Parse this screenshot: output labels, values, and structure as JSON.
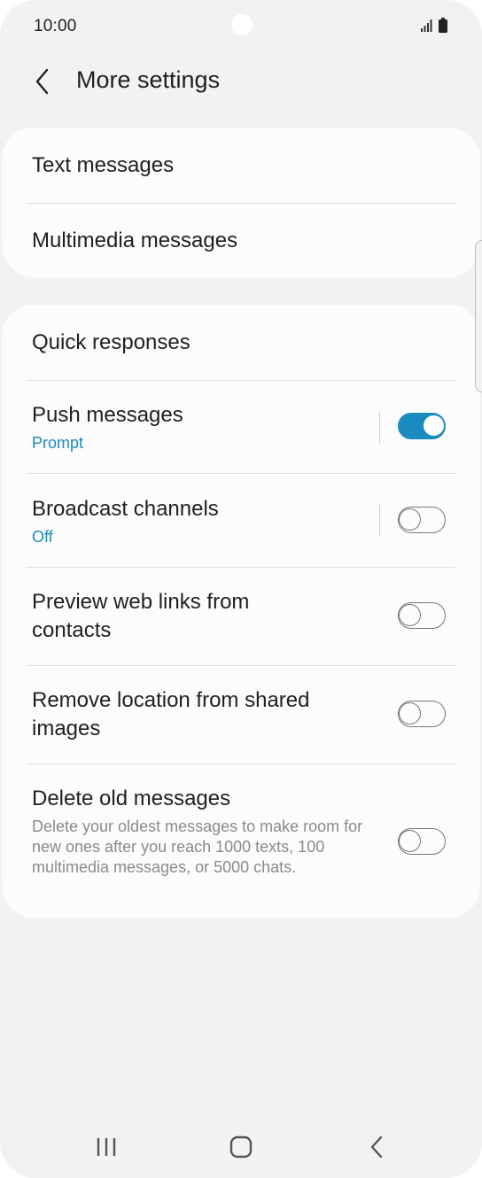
{
  "status_bar": {
    "time": "10:00",
    "icons": [
      "signal-icon",
      "battery-icon"
    ]
  },
  "app_bar": {
    "back_icon": "chevron-left-icon",
    "title": "More settings"
  },
  "group1": {
    "items": [
      {
        "label": "Text messages"
      },
      {
        "label": "Multimedia messages"
      }
    ]
  },
  "group2": {
    "quick_responses": {
      "label": "Quick responses"
    },
    "push_messages": {
      "label": "Push messages",
      "sub": "Prompt",
      "toggle_on": true
    },
    "broadcast_channels": {
      "label": "Broadcast channels",
      "sub": "Off",
      "toggle_on": false
    },
    "preview_links": {
      "line1": "Preview web links from",
      "line2": "contacts",
      "toggle_on": false
    },
    "remove_location": {
      "line1": "Remove location from shared",
      "line2": "images",
      "toggle_on": false
    },
    "delete_old": {
      "label": "Delete old messages",
      "desc": "Delete your oldest messages to make room for new ones after you reach 1000 texts, 100 multimedia messages, or 5000 chats.",
      "toggle_on": false
    }
  },
  "nav_bar": {
    "icons": [
      "recent-apps-icon",
      "home-icon",
      "back-icon"
    ]
  },
  "colors": {
    "accent": "#1a8bbf",
    "background": "#f2f2f2",
    "card": "#fcfcfc",
    "secondary_text": "#8a8a8a"
  }
}
